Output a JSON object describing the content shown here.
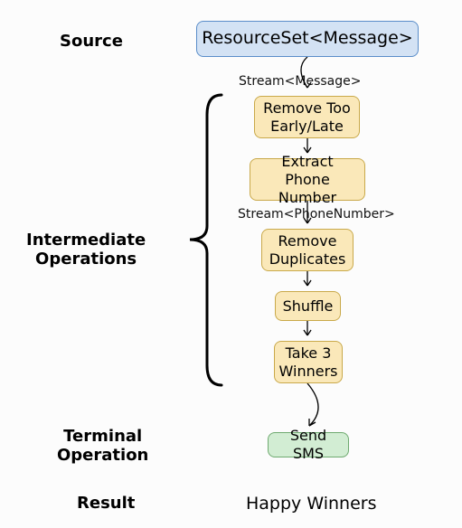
{
  "labels": {
    "source": "Source",
    "intermediate": "Intermediate\nOperations",
    "terminal": "Terminal\nOperation",
    "result": "Result"
  },
  "nodes": {
    "source": "ResourceSet<Message>",
    "removeEarlyLate": "Remove Too\nEarly/Late",
    "extractPhone": "Extract Phone\nNumber",
    "removeDup": "Remove\nDuplicates",
    "shuffle": "Shuffle",
    "take3": "Take 3\nWinners",
    "sendSms": "Send SMS"
  },
  "streams": {
    "message": "Stream<Message>",
    "phone": "Stream<PhoneNumber>"
  },
  "result": "Happy Winners"
}
